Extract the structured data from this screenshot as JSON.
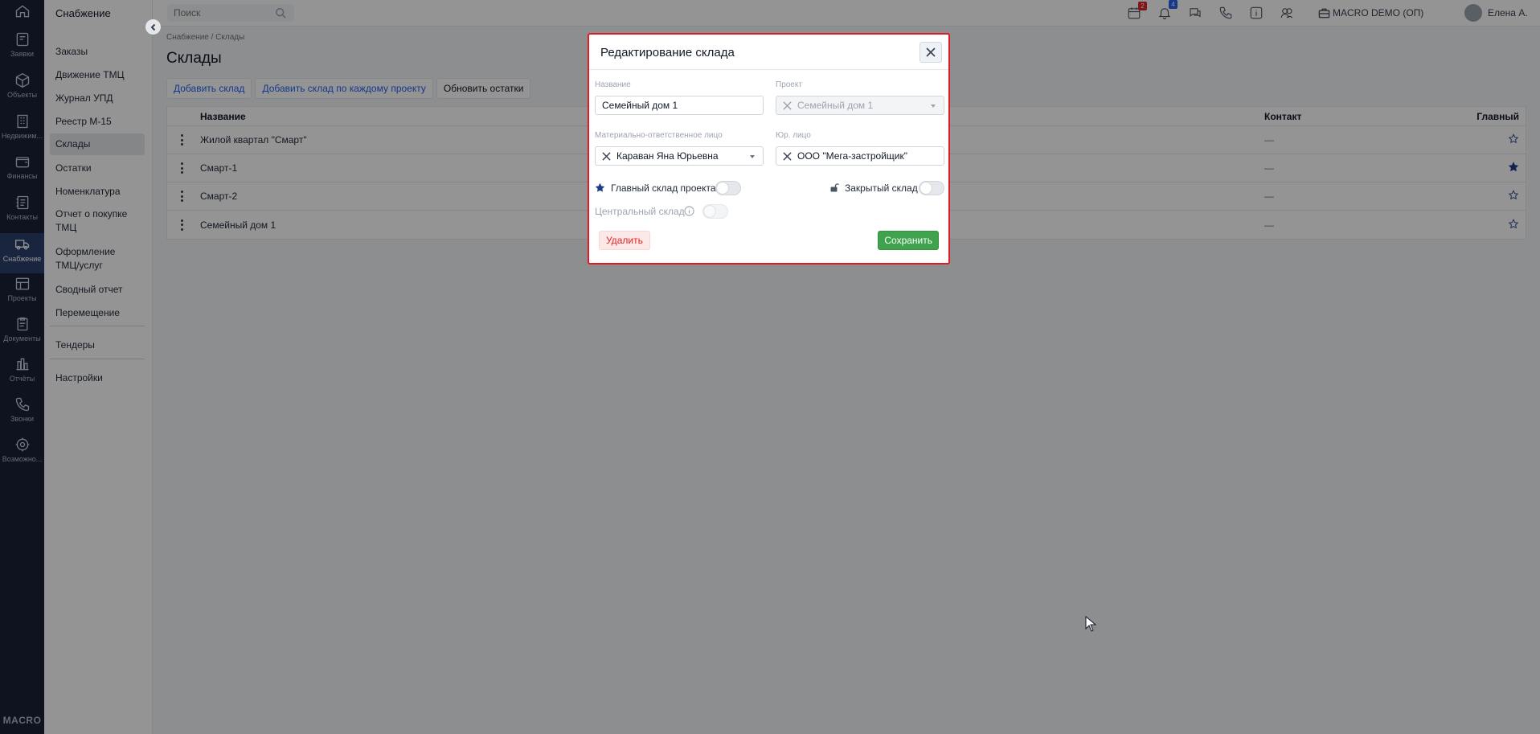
{
  "rail": {
    "items": [
      {
        "icon": "home-icon",
        "label": ""
      },
      {
        "icon": "orders-icon",
        "label": "Заявки"
      },
      {
        "icon": "cube-icon",
        "label": "Объекты"
      },
      {
        "icon": "building-icon",
        "label": "Недвижим..."
      },
      {
        "icon": "wallet-icon",
        "label": "Финансы"
      },
      {
        "icon": "contacts-icon",
        "label": "Контакты"
      },
      {
        "icon": "truck-icon",
        "label": "Снабжение"
      },
      {
        "icon": "projects-icon",
        "label": "Проекты"
      },
      {
        "icon": "documents-icon",
        "label": "Документы"
      },
      {
        "icon": "reports-icon",
        "label": "Отчёты"
      },
      {
        "icon": "phone-icon",
        "label": "Звонки"
      },
      {
        "icon": "gear-icon",
        "label": "Возможно..."
      }
    ],
    "active_index": 6,
    "brand": "MACRO"
  },
  "sidebar": {
    "title": "Снабжение",
    "items": [
      "Заказы",
      "Движение ТМЦ",
      "Журнал УПД",
      "Реестр М-15",
      "Склады",
      "Остатки",
      "Номенклатура",
      "Отчет о покупке ТМЦ",
      "Оформление ТМЦ/услуг",
      "Сводный отчет",
      "Перемещение",
      "Тендеры",
      "Настройки"
    ],
    "active": "Склады"
  },
  "topbar": {
    "search_placeholder": "Поиск",
    "calendar_badge": "2",
    "notifications_badge": "4",
    "org_name": "MACRO DEMO (ОП)",
    "user_name": "Елена А.",
    "colors": {
      "calendar_badge": "#dc2626",
      "notifications_badge": "#2563eb"
    }
  },
  "page": {
    "breadcrumb": "Снабжение / Склады",
    "title": "Склады",
    "buttons": {
      "add_warehouse": "Добавить склад",
      "add_per_project": "Добавить склад по каждому проекту",
      "refresh_balances": "Обновить остатки"
    },
    "table": {
      "headers": {
        "name": "Название",
        "contact": "Контакт",
        "main": "Главный"
      },
      "rows": [
        {
          "name": "Жилой квартал \"Смарт\"",
          "contact": "—",
          "main": false
        },
        {
          "name": "Смарт-1",
          "contact": "—",
          "main": true
        },
        {
          "name": "Смарт-2",
          "contact": "—",
          "main": false
        },
        {
          "name": "Семейный дом 1",
          "contact": "—",
          "main": false
        }
      ]
    }
  },
  "modal": {
    "title": "Редактирование склада",
    "fields": {
      "name_label": "Название",
      "name_value": "Семейный дом 1",
      "project_label": "Проект",
      "project_value": "Семейный дом 1",
      "responsible_label": "Материально-ответственное лицо",
      "responsible_value": "Караван Яна Юрьевна",
      "legal_label": "Юр. лицо",
      "legal_value": "ООО \"Мега-застройщик\""
    },
    "toggles": {
      "main_project_label": "Главный склад проекта",
      "main_project_on": false,
      "closed_label": "Закрытый склад",
      "closed_on": false,
      "central_label": "Центральный склад",
      "central_on": false
    },
    "delete_label": "Удалить",
    "save_label": "Сохранить"
  }
}
